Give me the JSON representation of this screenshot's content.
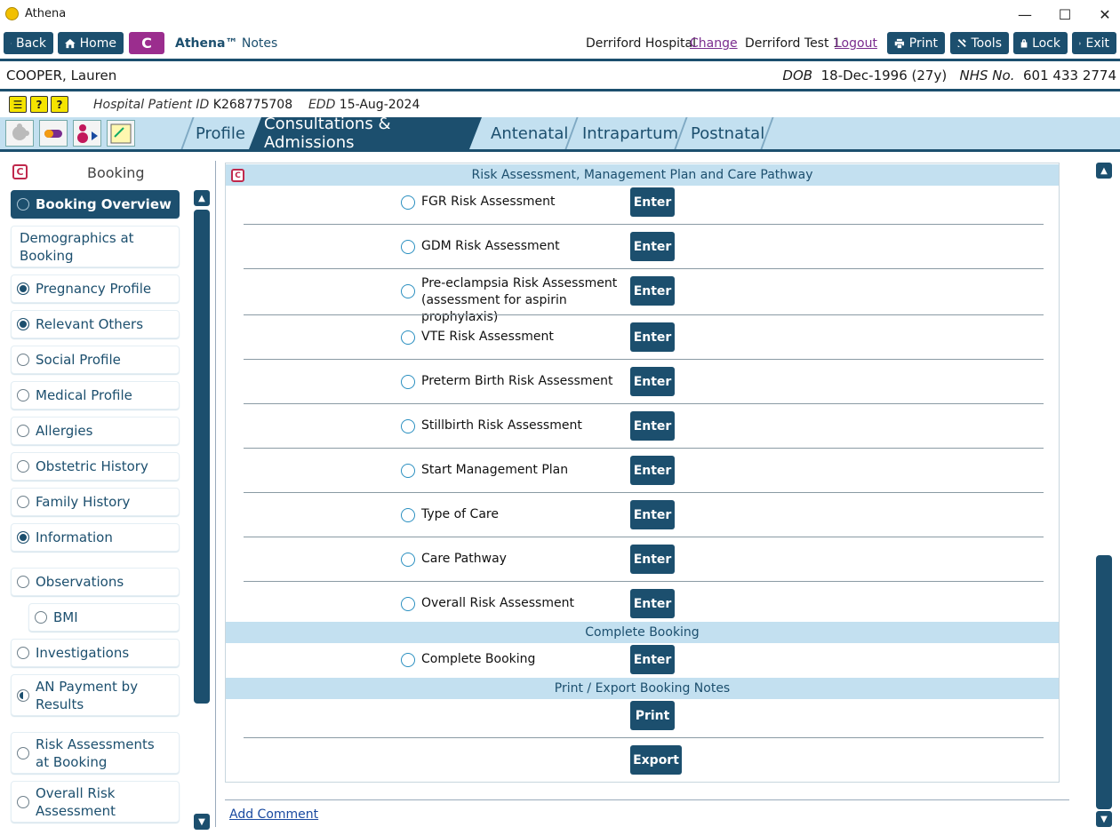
{
  "window": {
    "title": "Athena",
    "minimize": "—",
    "maximize": "☐",
    "close": "✕"
  },
  "toolbar": {
    "back_label": "Back",
    "home_label": "Home",
    "logo_letter": "C",
    "app_name": "Athena™",
    "app_module": "Notes",
    "hospital": "Derriford Hospital",
    "change_label": "Change",
    "user": "Derriford Test 1",
    "logout_label": "Logout",
    "print_label": "Print",
    "tools_label": "Tools",
    "lock_label": "Lock",
    "exit_label": "Exit"
  },
  "patient": {
    "name": "COOPER, Lauren",
    "dob_label": "DOB",
    "dob": "18-Dec-1996 (27y)",
    "nhs_label": "NHS No.",
    "nhs": "601 433 2774",
    "hospital_id_label": "Hospital Patient ID",
    "hospital_id": "K268775708",
    "edd_label": "EDD",
    "edd": "15-Aug-2024"
  },
  "tabs": [
    {
      "label": "Profile"
    },
    {
      "label": "Consultations & Admissions"
    },
    {
      "label": "Antenatal"
    },
    {
      "label": "Intrapartum"
    },
    {
      "label": "Postnatal"
    }
  ],
  "sidebar": {
    "title": "Booking",
    "items": [
      {
        "label": "Booking Overview",
        "state": "empty"
      },
      {
        "label": "Demographics at Booking",
        "state": "none"
      },
      {
        "label": "Pregnancy Profile",
        "state": "filled"
      },
      {
        "label": "Relevant Others",
        "state": "filled"
      },
      {
        "label": "Social Profile",
        "state": "empty"
      },
      {
        "label": "Medical Profile",
        "state": "empty"
      },
      {
        "label": "Allergies",
        "state": "empty"
      },
      {
        "label": "Obstetric History",
        "state": "empty"
      },
      {
        "label": "Family History",
        "state": "empty"
      },
      {
        "label": "Information",
        "state": "filled"
      },
      {
        "label": "Observations",
        "state": "empty"
      },
      {
        "label": "BMI",
        "state": "empty"
      },
      {
        "label": "Investigations",
        "state": "empty"
      },
      {
        "label": "AN Payment by Results",
        "state": "half"
      },
      {
        "label": "Risk Assessments at Booking",
        "state": "empty"
      },
      {
        "label": "Overall Risk Assessment",
        "state": "empty"
      }
    ]
  },
  "main": {
    "section_risk": "Risk Assessment, Management Plan and Care Pathway",
    "risk_rows": [
      {
        "label": "FGR Risk Assessment",
        "button": "Enter"
      },
      {
        "label": "GDM Risk Assessment",
        "button": "Enter"
      },
      {
        "label": "Pre-eclampsia Risk Assessment (assessment for aspirin prophylaxis)",
        "button": "Enter"
      },
      {
        "label": "VTE Risk Assessment",
        "button": "Enter"
      },
      {
        "label": "Preterm Birth Risk Assessment",
        "button": "Enter"
      },
      {
        "label": "Stillbirth Risk Assessment",
        "button": "Enter"
      },
      {
        "label": "Start Management Plan",
        "button": "Enter"
      },
      {
        "label": "Type of Care",
        "button": "Enter"
      },
      {
        "label": "Care Pathway",
        "button": "Enter"
      },
      {
        "label": "Overall Risk Assessment",
        "button": "Enter"
      }
    ],
    "section_complete": "Complete Booking",
    "complete_row": {
      "label": "Complete Booking",
      "button": "Enter"
    },
    "section_print": "Print / Export Booking Notes",
    "print_button": "Print",
    "export_button": "Export",
    "add_comment": "Add Comment"
  },
  "colors": {
    "primary": "#1c4f6e",
    "section_bg": "#c3e0f0",
    "accent_purple": "#9b2d8e",
    "link": "#7a2c8e"
  }
}
